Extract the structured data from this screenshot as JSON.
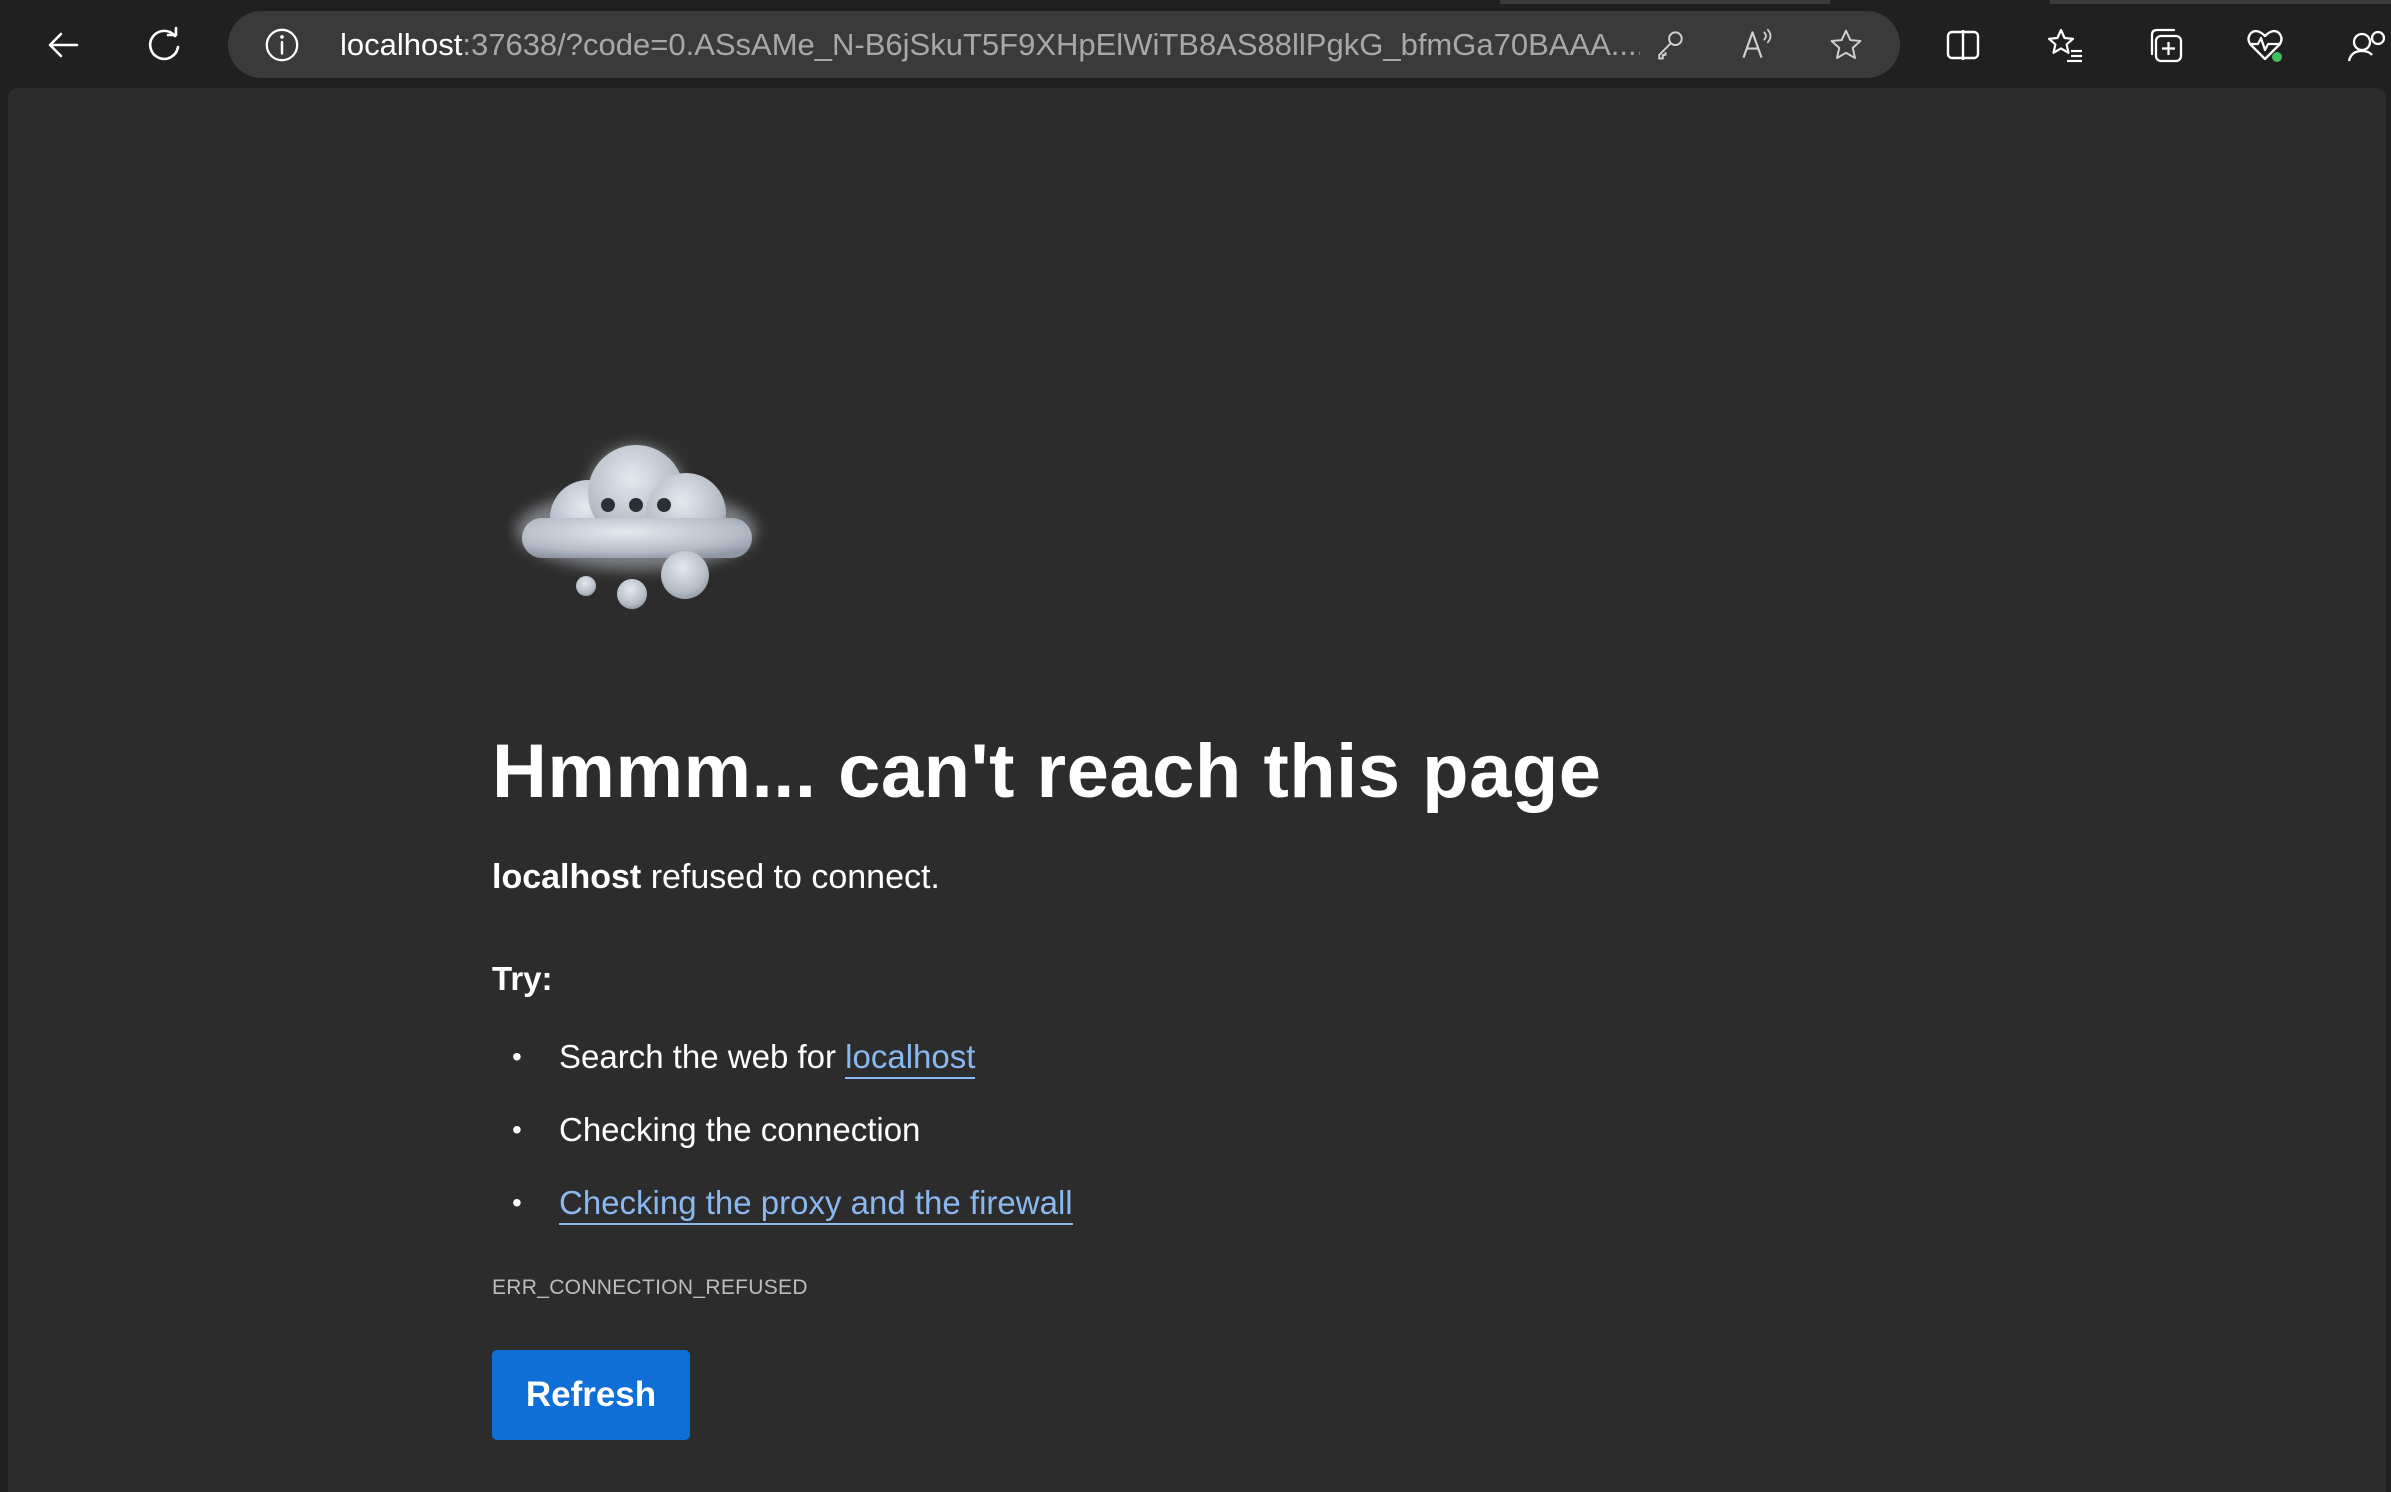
{
  "browser": {
    "url_host": "localhost",
    "url_rest": ":37638/?code=0.ASsAMe_N-B6jSkuT5F9XHpElWiTB8AS88llPgkG_bfmGa70BAAA....",
    "icons": [
      "back-icon",
      "refresh-icon",
      "info-icon",
      "key-icon",
      "read-aloud-icon",
      "favorite-star-icon",
      "split-screen-icon",
      "favorites-icon",
      "collections-icon",
      "browser-essentials-icon",
      "profile-icon"
    ],
    "read_aloud_glyph": "A⁾"
  },
  "error_page": {
    "illustration": "thought-cloud-icon",
    "heading": "Hmmm... can't reach this page",
    "host": "localhost",
    "message": " refused to connect.",
    "try_label": "Try:",
    "suggestion_1_prefix": "Search the web for ",
    "suggestion_1_link": "localhost",
    "suggestion_2": "Checking the connection",
    "suggestion_3_link": "Checking the proxy and the firewall",
    "error_code": "ERR_CONNECTION_REFUSED",
    "refresh_label": "Refresh"
  },
  "colors": {
    "background": "#202020",
    "content": "#2c2c2c",
    "link": "#8ab8f0",
    "button": "#0f6fd6",
    "health_dot": "#3fbf5f"
  }
}
